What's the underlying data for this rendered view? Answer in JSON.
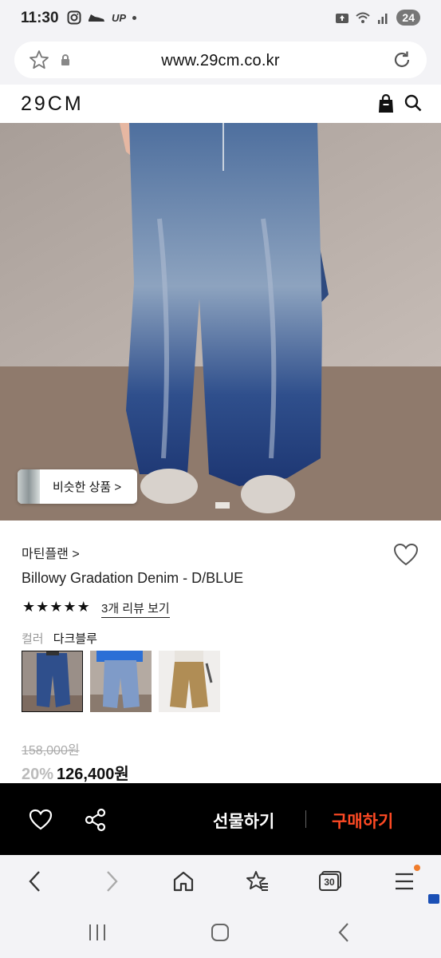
{
  "status_bar": {
    "time": "11:30",
    "up_label": "UP",
    "battery": "24",
    "icons": [
      "instagram-icon",
      "shoe-icon",
      "notification-dot-icon",
      "upload-icon",
      "wifi-icon",
      "signal-icon",
      "battery-icon"
    ]
  },
  "browser": {
    "url": "www.29cm.co.kr",
    "icons": [
      "star-icon",
      "lock-icon",
      "reload-icon"
    ]
  },
  "site": {
    "logo": "29CM",
    "icons": [
      "shopping-bag-icon",
      "search-icon"
    ]
  },
  "product_image": {
    "similar_button_label": "비슷한 상품 >"
  },
  "product": {
    "brand": "마틴플랜 >",
    "name": "Billowy Gradation Denim - D/BLUE",
    "rating_stars": 5,
    "review_link": "3개 리뷰 보기",
    "color_label": "컬러",
    "color_value": "다크블루",
    "swatches": [
      {
        "name": "dark-blue",
        "selected": true
      },
      {
        "name": "light-blue",
        "selected": false
      },
      {
        "name": "beige",
        "selected": false
      }
    ],
    "original_price": "158,000원",
    "discount": "20%",
    "sale_price": "126,400원"
  },
  "action_bar": {
    "gift_label": "선물하기",
    "buy_label": "구매하기",
    "buy_color": "#ff4a24",
    "icons": [
      "heart-icon",
      "share-icon"
    ]
  },
  "browser_nav": {
    "tabs_count": "30",
    "icons": [
      "back-icon",
      "forward-icon",
      "home-icon",
      "bookmark-icon",
      "tabs-icon",
      "menu-icon"
    ]
  },
  "system_nav": {
    "icons": [
      "recent-apps-icon",
      "home-button-icon",
      "back-button-icon"
    ]
  }
}
